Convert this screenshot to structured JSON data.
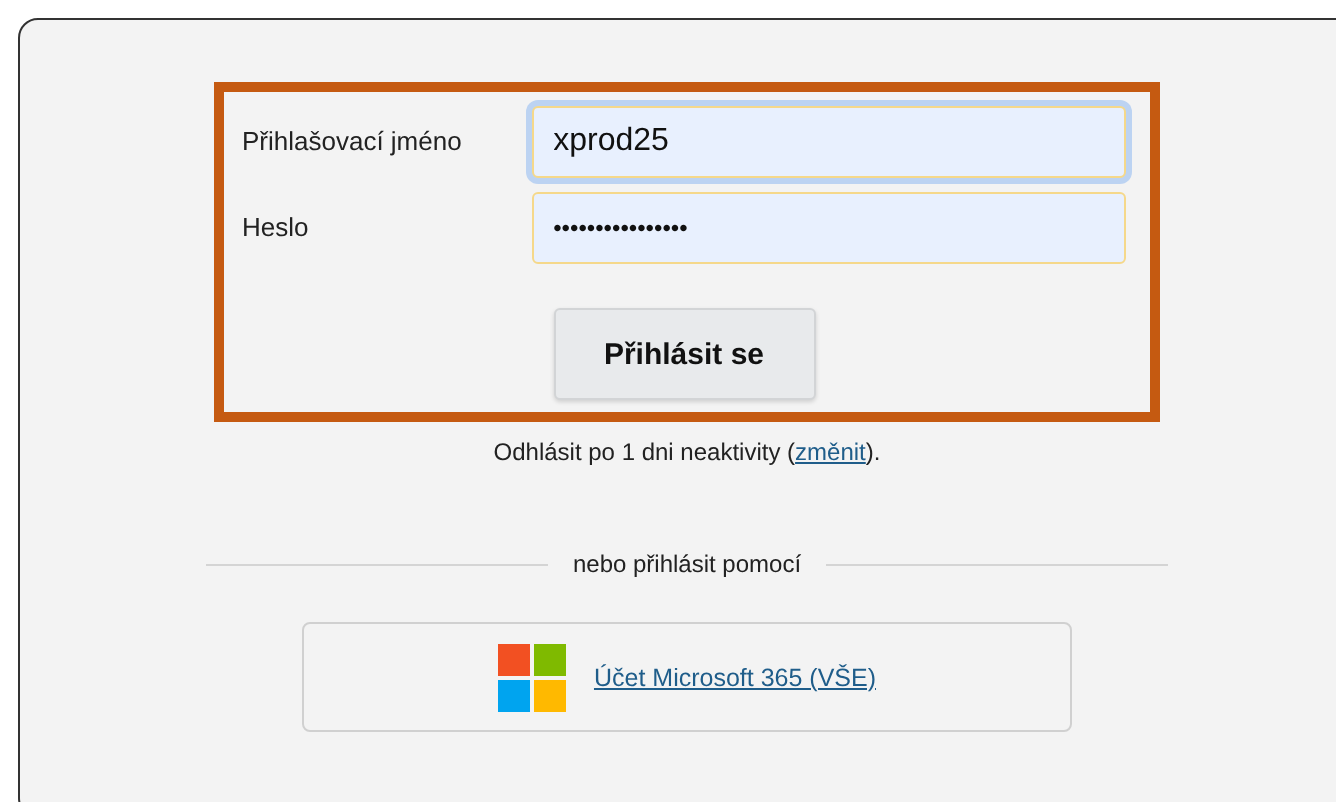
{
  "login_form": {
    "username": {
      "label": "Přihlašovací jméno",
      "value": "xprod25",
      "focused": true
    },
    "password": {
      "label": "Heslo",
      "value": "••••••••••••••••",
      "focused": false
    },
    "submit_button": "Přihlásit se"
  },
  "logout_note": {
    "before": "Odhlásit po 1 dni neaktivity (",
    "link": "změnit",
    "after": ")."
  },
  "divider_label": "nebo přihlásit pomocí",
  "sso_button": {
    "label": "Účet Microsoft 365 (VŠE)"
  }
}
